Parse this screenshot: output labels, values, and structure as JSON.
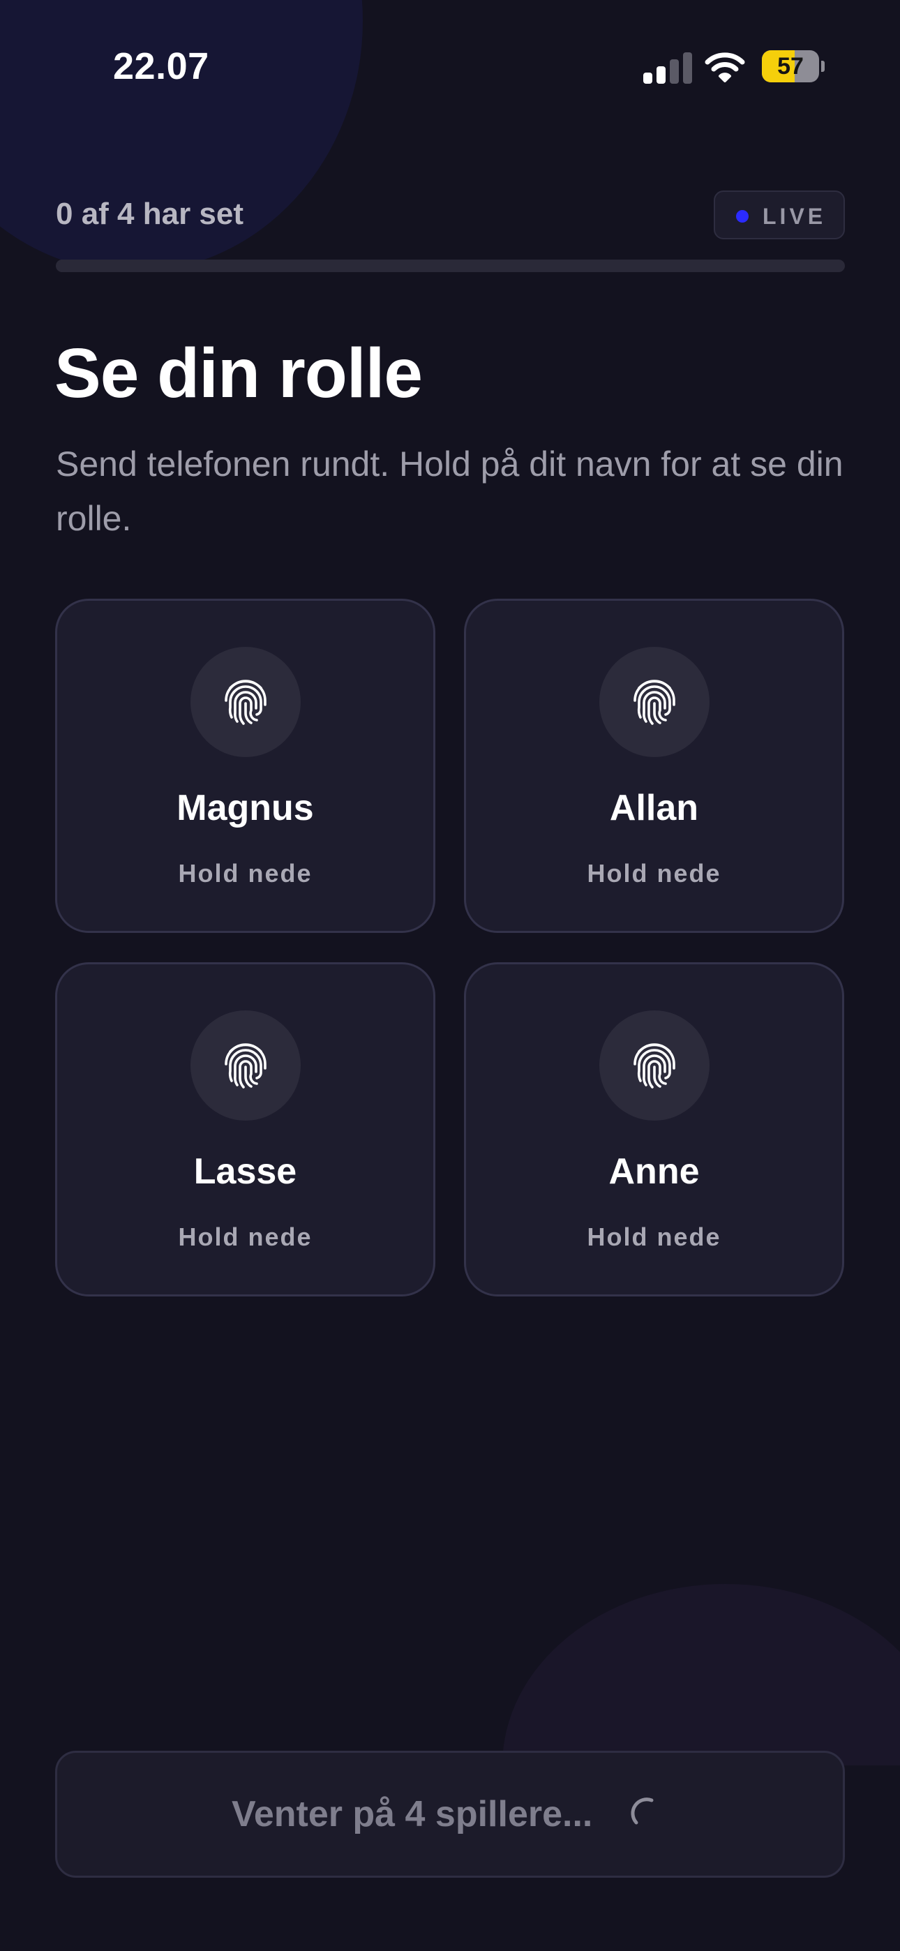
{
  "status_bar": {
    "time": "22.07",
    "signal_bars_active": 2,
    "signal_bars_total": 4,
    "wifi_icon": "wifi-icon",
    "battery_percent": 57
  },
  "progress": {
    "label": "0 af 4 har set",
    "seen": 0,
    "total": 4,
    "live_label": "LIVE",
    "live_color": "#2b2bff"
  },
  "header": {
    "title": "Se din rolle",
    "subtitle": "Send telefonen rundt. Hold på dit navn for at se din rolle."
  },
  "players": [
    {
      "name": "Magnus",
      "hint": "Hold nede",
      "icon": "fingerprint-icon"
    },
    {
      "name": "Allan",
      "hint": "Hold nede",
      "icon": "fingerprint-icon"
    },
    {
      "name": "Lasse",
      "hint": "Hold nede",
      "icon": "fingerprint-icon"
    },
    {
      "name": "Anne",
      "hint": "Hold nede",
      "icon": "fingerprint-icon"
    }
  ],
  "footer": {
    "button_label": "Venter på 4 spillere...",
    "spinner_icon": "loading-spinner-icon"
  },
  "colors": {
    "background": "#13121f",
    "card": "#1d1c2d",
    "text_primary": "#ffffff",
    "text_secondary": "#9e9daa",
    "battery": "#f5cf0b"
  }
}
